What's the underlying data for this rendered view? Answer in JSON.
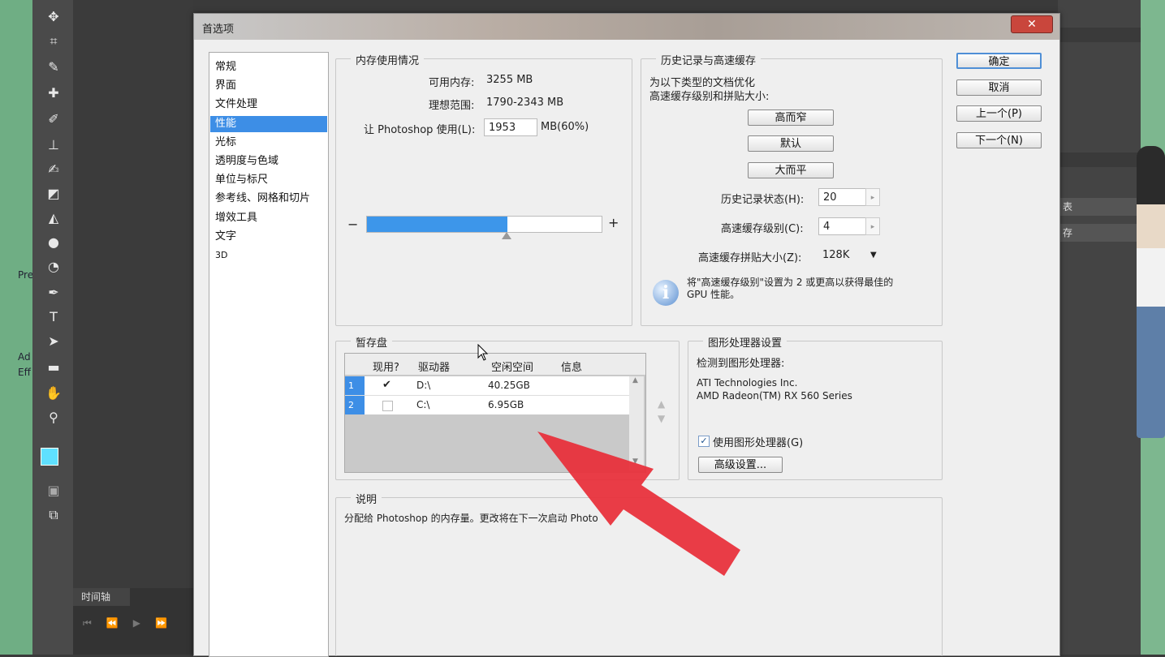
{
  "background": {
    "left_fragments": [
      "Pre",
      "Ad",
      "Eff"
    ],
    "timeline_label": "时间轴",
    "right_dropdowns": [
      "表",
      "存"
    ]
  },
  "dialog": {
    "title": "首选项",
    "close_glyph": "✕",
    "nav_items": [
      {
        "label": "常规",
        "selected": false
      },
      {
        "label": "界面",
        "selected": false
      },
      {
        "label": "文件处理",
        "selected": false
      },
      {
        "label": "性能",
        "selected": true
      },
      {
        "label": "光标",
        "selected": false
      },
      {
        "label": "透明度与色域",
        "selected": false
      },
      {
        "label": "单位与标尺",
        "selected": false
      },
      {
        "label": "参考线、网格和切片",
        "selected": false
      },
      {
        "label": "增效工具",
        "selected": false
      },
      {
        "label": "文字",
        "selected": false
      },
      {
        "label": "3D",
        "selected": false
      }
    ],
    "buttons": {
      "ok": "确定",
      "cancel": "取消",
      "prev": "上一个(P)",
      "next": "下一个(N)"
    },
    "memory": {
      "title": "内存使用情况",
      "available_label": "可用内存:",
      "available_value": "3255 MB",
      "ideal_label": "理想范围:",
      "ideal_value": "1790-2343 MB",
      "use_label": "让 Photoshop 使用(L):",
      "use_value": "1953",
      "use_unit": "MB(60%)",
      "slider_fraction": 0.6,
      "minus": "−",
      "plus": "+"
    },
    "history": {
      "title": "历史记录与高速缓存",
      "desc_line1": "为以下类型的文档优化",
      "desc_line2": "高速缓存级别和拼贴大小:",
      "btn_tall_thin": "高而窄",
      "btn_default": "默认",
      "btn_big_flat": "大而平",
      "states_label": "历史记录状态(H):",
      "states_value": "20",
      "cache_levels_label": "高速缓存级别(C):",
      "cache_levels_value": "4",
      "tile_size_label": "高速缓存拼贴大小(Z):",
      "tile_size_value": "128K",
      "info_line1": "将\"高速缓存级别\"设置为 2 或更高以获得最佳的",
      "info_line2": "GPU 性能。"
    },
    "scratch": {
      "title": "暂存盘",
      "columns": [
        "现用?",
        "驱动器",
        "空闲空间",
        "信息"
      ],
      "rows": [
        {
          "num": "1",
          "active": true,
          "drive": "D:\\",
          "free": "40.25GB",
          "info": ""
        },
        {
          "num": "2",
          "active": false,
          "drive": "C:\\",
          "free": "6.95GB",
          "info": ""
        }
      ]
    },
    "gpu": {
      "title": "图形处理器设置",
      "detected_label": "检测到图形处理器:",
      "vendor": "ATI Technologies Inc.",
      "model": "AMD Radeon(TM) RX 560 Series",
      "use_gpu_label": "使用图形处理器(G)",
      "use_gpu_checked": true,
      "advanced_btn": "高级设置..."
    },
    "description": {
      "title": "说明",
      "text": "分配给 Photoshop 的内存量。更改将在下一次启动 Photo"
    }
  },
  "colors": {
    "accent": "#3d96ea",
    "selection": "#3d8ee6",
    "arrow": "#e8323c"
  }
}
